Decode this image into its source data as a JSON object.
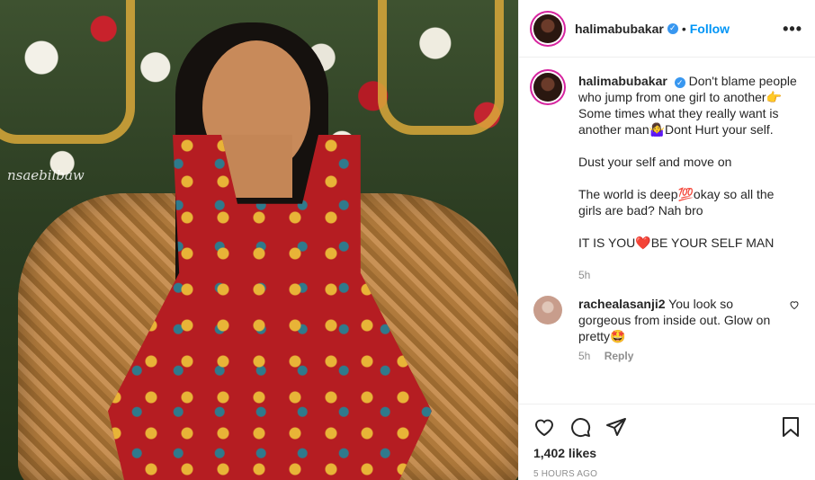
{
  "post": {
    "username": "halimabubakar",
    "follow_label": "Follow",
    "dot": "•",
    "more_label": "•••",
    "photo_watermark": "nsaebilbaw"
  },
  "caption": {
    "username": "halimabubakar",
    "lines": [
      "Don't blame people who jump from one girl to another👉 Some times what they really want is another man🤷‍♀️Dont Hurt your self.",
      "Dust your self and move on",
      "The world is deep💯okay so all the girls are bad? Nah bro",
      "IT IS YOU❤️BE YOUR SELF MAN"
    ],
    "time": "5h"
  },
  "comments": [
    {
      "username": "rachealasanji2",
      "text": "You look so gorgeous from inside out. Glow on pretty🤩",
      "time": "5h",
      "reply_label": "Reply"
    }
  ],
  "actions": {
    "likes": "1,402 likes",
    "posted": "5 HOURS AGO"
  },
  "colors": {
    "link": "#0095f6",
    "verified": "#3897f0",
    "muted": "#8e8e8e",
    "text": "#262626"
  },
  "icons": [
    "verified-icon",
    "more-options-icon",
    "heart-icon",
    "comment-icon",
    "share-icon",
    "bookmark-icon",
    "small-heart-icon"
  ]
}
